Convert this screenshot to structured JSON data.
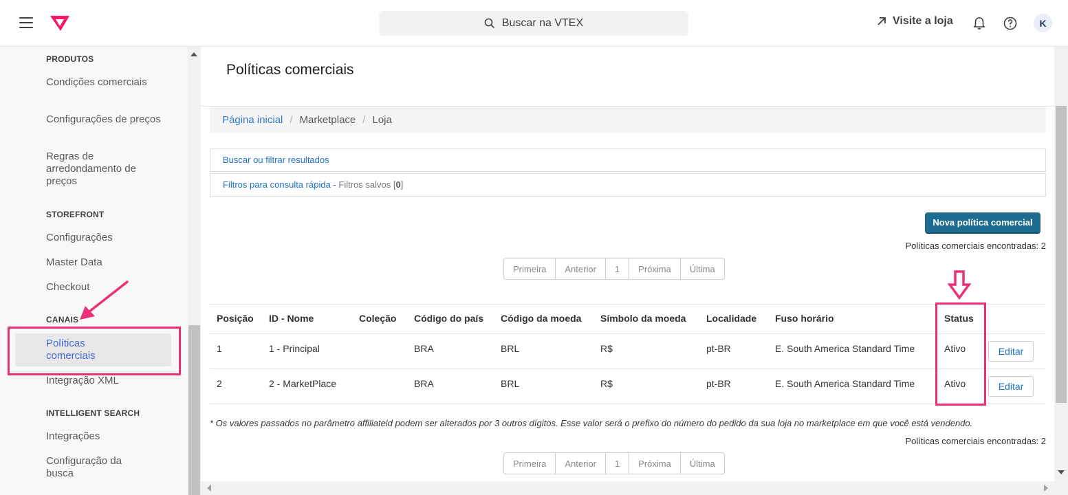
{
  "topbar": {
    "search_placeholder": "Buscar na VTEX",
    "visit_label": "Visite a loja",
    "avatar_initial": "K"
  },
  "sidebar": {
    "sections": [
      {
        "title": "PRODUTOS",
        "items": [
          "Condições comerciais",
          "Configurações de preços",
          "Regras de arredondamento de preços"
        ]
      },
      {
        "title": "STOREFRONT",
        "items": [
          "Configurações",
          "Master Data",
          "Checkout"
        ]
      },
      {
        "title": "CANAIS",
        "items": [
          "Políticas comerciais",
          "Integração XML"
        ]
      },
      {
        "title": "INTELLIGENT SEARCH",
        "items": [
          "Integrações",
          "Configuração da busca"
        ]
      }
    ]
  },
  "page": {
    "title": "Políticas comerciais",
    "breadcrumb": {
      "home": "Página inicial",
      "level2": "Marketplace",
      "level3": "Loja"
    },
    "filter_search": "Buscar ou filtrar resultados",
    "quick_filters_label": "Filtros para consulta rápida -",
    "saved_filters_label": "Filtros salvos [",
    "saved_filters_count": "0",
    "saved_filters_close": "]",
    "new_button": "Nova política comercial",
    "found_text": "Políticas comerciais encontradas: 2",
    "pager": {
      "first": "Primeira",
      "prev": "Anterior",
      "page": "1",
      "next": "Próxima",
      "last": "Última"
    },
    "note": "* Os valores passados no parâmetro affiliateid podem ser alterados por 3 outros dígitos. Esse valor será o prefixo do número do pedido da sua loja no marketplace em que você está vendendo."
  },
  "table": {
    "headers": [
      "Posição",
      "ID - Nome",
      "Coleção",
      "Código do país",
      "Código da moeda",
      "Símbolo da moeda",
      "Localidade",
      "Fuso horário",
      "Status"
    ],
    "rows": [
      {
        "pos": "1",
        "name": "1 - Principal",
        "collection": "",
        "country": "BRA",
        "currency": "BRL",
        "symbol": "R$",
        "locale": "pt-BR",
        "tz": "E. South America Standard Time",
        "status": "Ativo",
        "edit": "Editar"
      },
      {
        "pos": "2",
        "name": "2 - MarketPlace",
        "collection": "",
        "country": "BRA",
        "currency": "BRL",
        "symbol": "R$",
        "locale": "pt-BR",
        "tz": "E. South America Standard Time",
        "status": "Ativo",
        "edit": "Editar"
      }
    ]
  },
  "colors": {
    "accent": "#ec2f76",
    "link": "#1f74c9",
    "primary_button": "#1d6b8e"
  }
}
